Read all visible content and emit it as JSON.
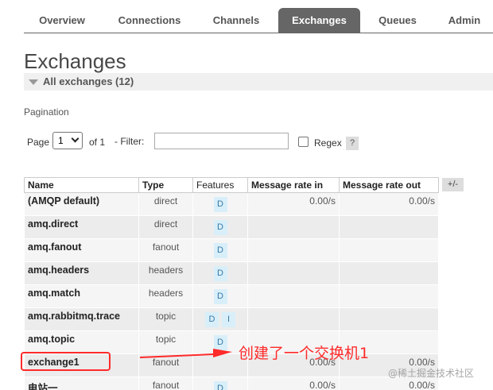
{
  "nav": {
    "tabs": [
      {
        "label": "Overview",
        "active": false
      },
      {
        "label": "Connections",
        "active": false
      },
      {
        "label": "Channels",
        "active": false
      },
      {
        "label": "Exchanges",
        "active": true
      },
      {
        "label": "Queues",
        "active": false
      },
      {
        "label": "Admin",
        "active": false
      }
    ]
  },
  "page": {
    "title": "Exchanges",
    "section_label": "All exchanges (12)"
  },
  "pagination": {
    "heading": "Pagination",
    "page_label": "Page",
    "page_value": "1",
    "of_label": "of 1",
    "filter_label": "- Filter:",
    "filter_value": "",
    "regex_label": "Regex",
    "regex_checked": false,
    "help_label": "?"
  },
  "table": {
    "headers": {
      "name": "Name",
      "type": "Type",
      "features": "Features",
      "rate_in": "Message rate in",
      "rate_out": "Message rate out"
    },
    "plus_minus": "+/-",
    "rows": [
      {
        "name": "(AMQP default)",
        "type": "direct",
        "features": [
          "D"
        ],
        "rate_in": "0.00/s",
        "rate_out": "0.00/s"
      },
      {
        "name": "amq.direct",
        "type": "direct",
        "features": [
          "D"
        ],
        "rate_in": "",
        "rate_out": ""
      },
      {
        "name": "amq.fanout",
        "type": "fanout",
        "features": [
          "D"
        ],
        "rate_in": "",
        "rate_out": ""
      },
      {
        "name": "amq.headers",
        "type": "headers",
        "features": [
          "D"
        ],
        "rate_in": "",
        "rate_out": ""
      },
      {
        "name": "amq.match",
        "type": "headers",
        "features": [
          "D"
        ],
        "rate_in": "",
        "rate_out": ""
      },
      {
        "name": "amq.rabbitmq.trace",
        "type": "topic",
        "features": [
          "D",
          "I"
        ],
        "rate_in": "",
        "rate_out": ""
      },
      {
        "name": "amq.topic",
        "type": "topic",
        "features": [
          "D"
        ],
        "rate_in": "",
        "rate_out": ""
      },
      {
        "name": "exchange1",
        "type": "fanout",
        "features": [],
        "rate_in": "0.00/s",
        "rate_out": "0.00/s"
      },
      {
        "name": "电站一",
        "type": "fanout",
        "features": [
          "D"
        ],
        "rate_in": "0.00/s",
        "rate_out": "0.00/s"
      }
    ]
  },
  "annotation": {
    "text": "创建了一个交换机1",
    "color": "#ff2a2a"
  },
  "watermark": "@稀土掘金技术社区"
}
